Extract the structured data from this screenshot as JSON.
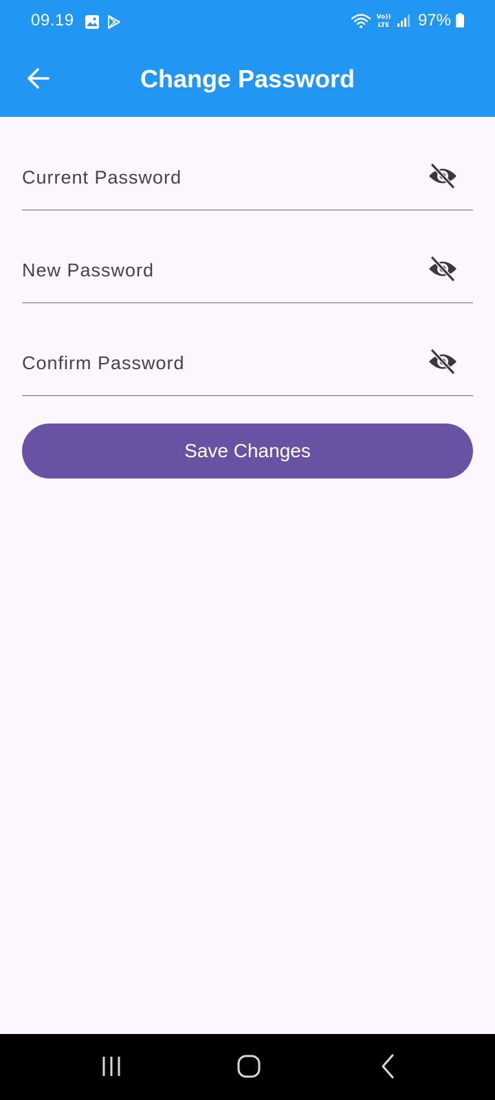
{
  "status_bar": {
    "time": "09.19",
    "battery": "97%",
    "icons": [
      "gallery-icon",
      "play-store-icon",
      "wifi-icon",
      "volte-icon",
      "signal-icon",
      "battery-icon"
    ]
  },
  "app_bar": {
    "title": "Change Password",
    "back_icon": "arrow-back-icon",
    "background_color": "#2196f3"
  },
  "form": {
    "fields": [
      {
        "placeholder": "Current Password",
        "value": "",
        "toggle_icon": "visibility-off-icon"
      },
      {
        "placeholder": "New Password",
        "value": "",
        "toggle_icon": "visibility-off-icon"
      },
      {
        "placeholder": "Confirm Password",
        "value": "",
        "toggle_icon": "visibility-off-icon"
      }
    ],
    "save_label": "Save Changes",
    "button_color": "#6951a3"
  },
  "nav_bar": {
    "buttons": [
      "recents-icon",
      "home-icon",
      "back-icon"
    ]
  },
  "colors": {
    "background": "#fcf6fe",
    "primary": "#2196f3",
    "accent": "#6951a3"
  }
}
